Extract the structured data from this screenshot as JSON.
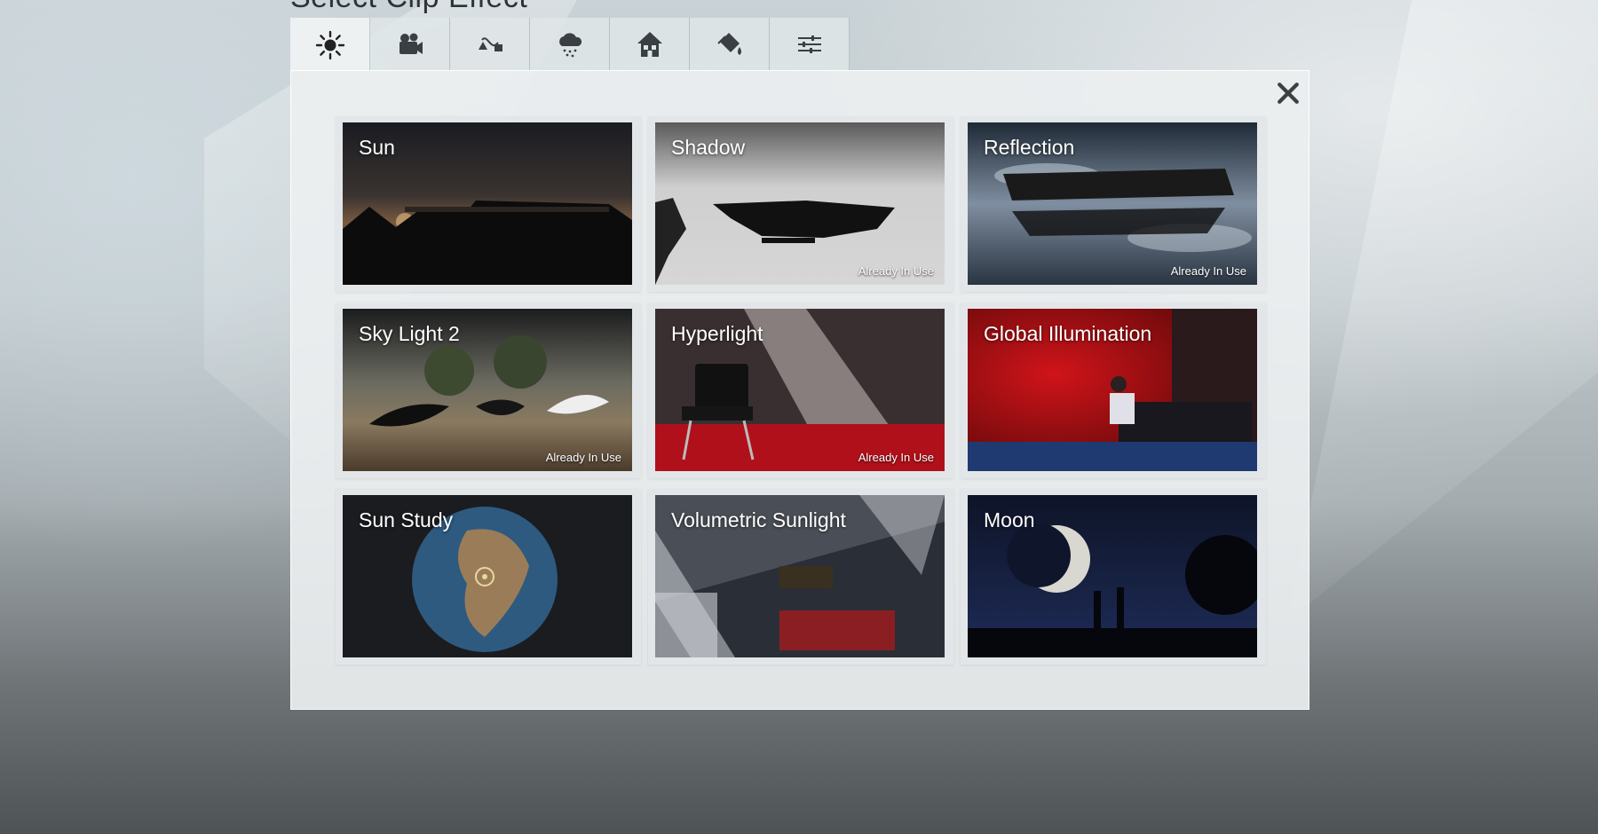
{
  "dialog": {
    "title": "Select Clip Effect",
    "close_label": "✕"
  },
  "tabs": [
    {
      "name": "sun-tab",
      "icon": "sun-icon",
      "active": true
    },
    {
      "name": "camera-tab",
      "icon": "movie-camera-icon",
      "active": false
    },
    {
      "name": "animation-tab",
      "icon": "path-animation-icon",
      "active": false
    },
    {
      "name": "weather-tab",
      "icon": "rain-cloud-icon",
      "active": false
    },
    {
      "name": "building-tab",
      "icon": "house-icon",
      "active": false
    },
    {
      "name": "paint-tab",
      "icon": "paint-bucket-icon",
      "active": false
    },
    {
      "name": "adjust-tab",
      "icon": "sliders-icon",
      "active": false
    }
  ],
  "effects": [
    {
      "title": "Sun",
      "badge": ""
    },
    {
      "title": "Shadow",
      "badge": "Already In Use"
    },
    {
      "title": "Reflection",
      "badge": "Already In Use"
    },
    {
      "title": "Sky Light 2",
      "badge": "Already In Use"
    },
    {
      "title": "Hyperlight",
      "badge": "Already In Use"
    },
    {
      "title": "Global Illumination",
      "badge": ""
    },
    {
      "title": "Sun Study",
      "badge": ""
    },
    {
      "title": "Volumetric Sunlight",
      "badge": ""
    },
    {
      "title": "Moon",
      "badge": ""
    }
  ],
  "colors": {
    "panel": "#eceff0",
    "icon": "#3a3f43",
    "card_text": "#ffffff"
  }
}
